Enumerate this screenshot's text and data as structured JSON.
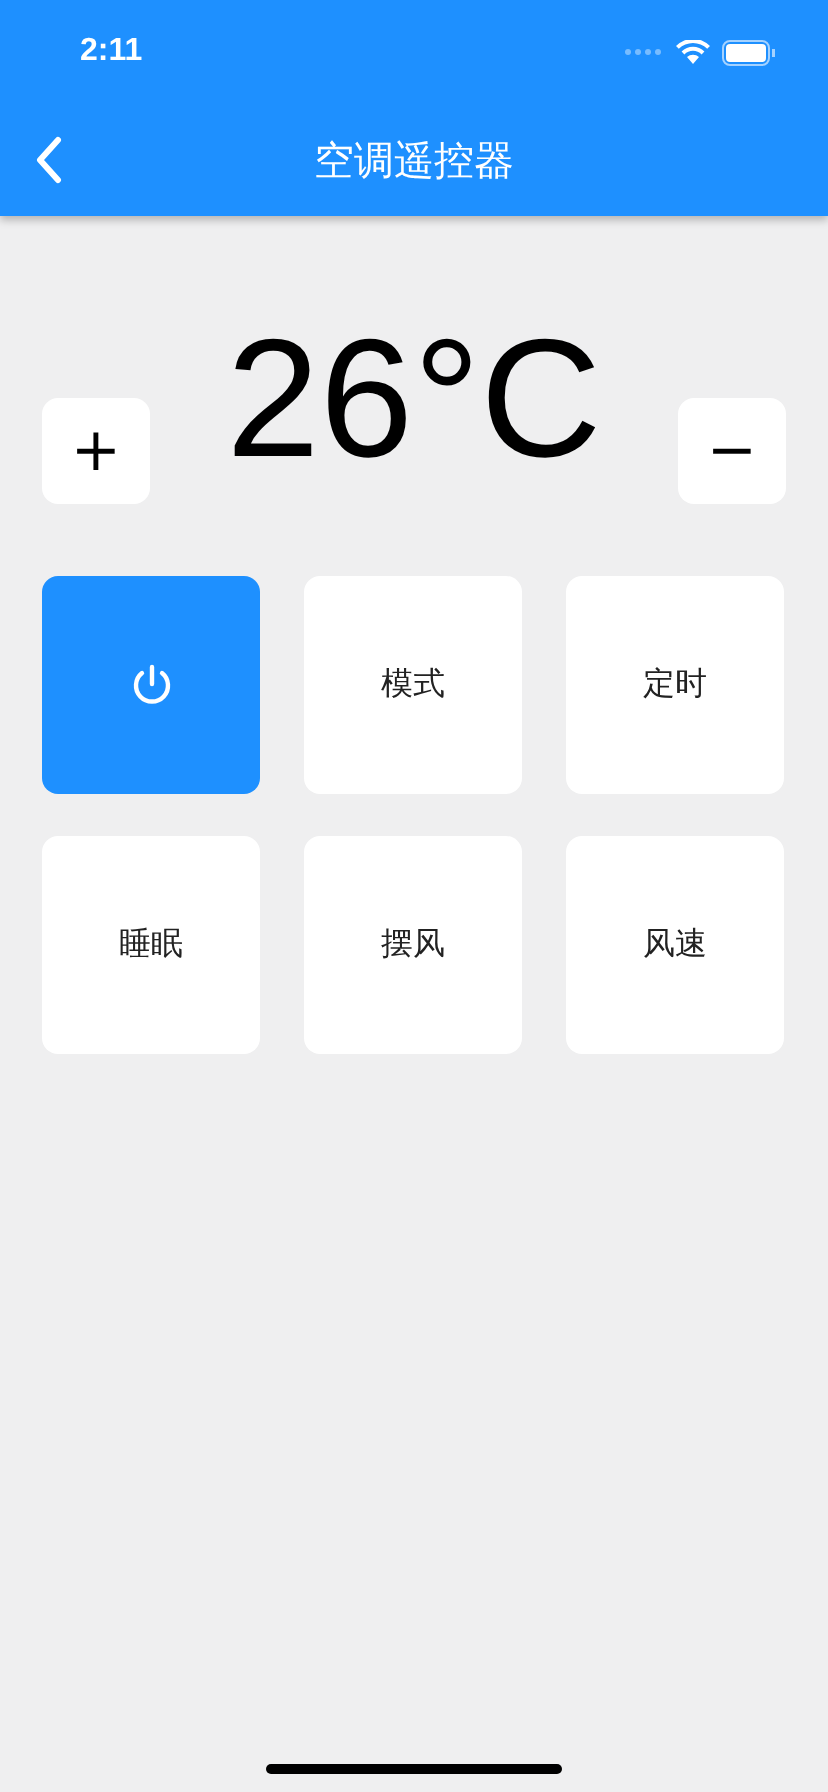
{
  "status_bar": {
    "time": "2:11"
  },
  "nav_bar": {
    "title": "空调遥控器"
  },
  "temperature": {
    "increase": "+",
    "value": "26°C",
    "decrease": "−"
  },
  "buttons": [
    {
      "kind": "power",
      "selected": true
    },
    {
      "kind": "text",
      "label": "模式",
      "selected": false
    },
    {
      "kind": "text",
      "label": "定时",
      "selected": false
    },
    {
      "kind": "text",
      "label": "睡眠",
      "selected": false
    },
    {
      "kind": "text",
      "label": "摆风",
      "selected": false
    },
    {
      "kind": "text",
      "label": "风速",
      "selected": false
    }
  ]
}
